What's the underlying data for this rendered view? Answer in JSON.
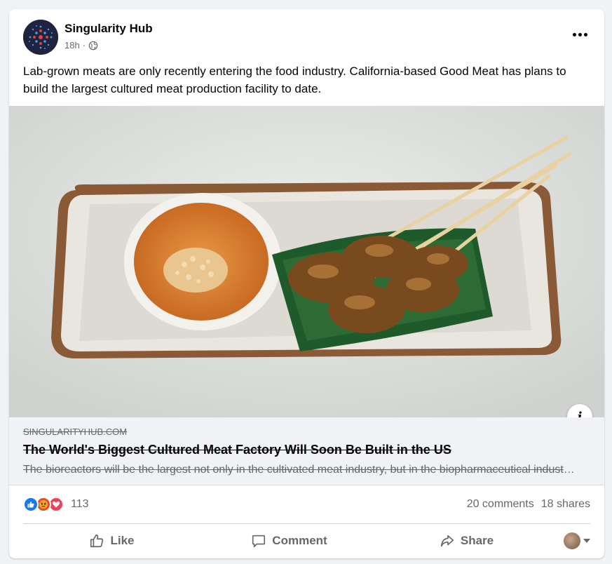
{
  "post": {
    "page_name": "Singularity Hub",
    "time": "18h",
    "meta_separator": "·",
    "privacy_icon": "globe-icon",
    "text": "Lab-grown meats are only recently entering the food industry. California-based Good Meat has plans to build the largest cultured meat production facility to date.",
    "more_icon": "more-options-icon"
  },
  "image": {
    "info_glyph": "i"
  },
  "link": {
    "domain": "SINGULARITYHUB.COM",
    "title": "The World's Biggest Cultured Meat Factory Will Soon Be Built in the US",
    "description": "The bioreactors will be the largest not only in the cultivated meat industry, but in the biopharmaceutical industry as well."
  },
  "engagement": {
    "reactions": [
      "like",
      "angry",
      "love"
    ],
    "reaction_count": "113",
    "comments": "20 comments",
    "shares": "18 shares"
  },
  "actions": {
    "like": "Like",
    "comment": "Comment",
    "share": "Share"
  },
  "colors": {
    "facebook_blue": "#1877f2",
    "secondary_text": "#65676b",
    "background": "#f0f2f5"
  }
}
